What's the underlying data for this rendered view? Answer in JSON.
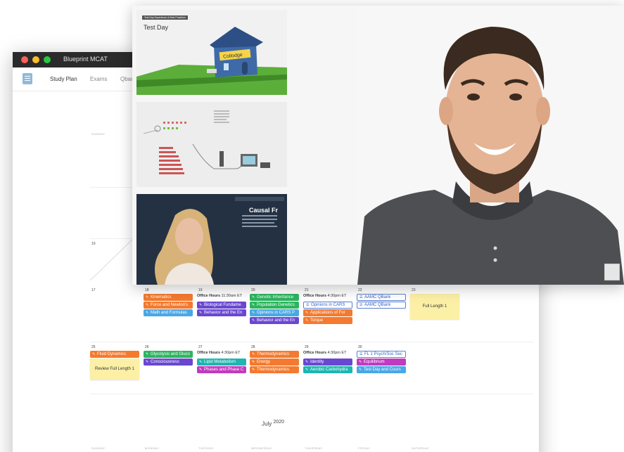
{
  "window": {
    "title": "Blueprint MCAT"
  },
  "nav": {
    "items": [
      "Study Plan",
      "Exams",
      "Qban"
    ]
  },
  "calendar": {
    "week_header_top": {
      "sunday": "SUNDAY"
    },
    "partial_day": "10",
    "week1": {
      "days": [
        "17",
        "18",
        "19",
        "20",
        "21",
        "22",
        "23"
      ],
      "events": [
        {
          "day": "18",
          "label": "Kinematics",
          "color": "orange"
        },
        {
          "day": "18",
          "label": "Force and Newton's",
          "color": "orange"
        },
        {
          "day": "18",
          "label": "Math and Formulas",
          "color": "blue"
        },
        {
          "day": "19",
          "label": "Biological Fundame",
          "color": "purple"
        },
        {
          "day": "19",
          "label": "Behavior and the En",
          "color": "purple"
        },
        {
          "day": "20",
          "label": "Genetic Inheritance",
          "color": "green"
        },
        {
          "day": "20",
          "label": "Population Genetics",
          "color": "green"
        },
        {
          "day": "20",
          "label": "Opinions in CARS P",
          "color": "blue"
        },
        {
          "day": "20",
          "label": "Behavior and the En",
          "color": "purple"
        },
        {
          "day": "21",
          "label": "Opinions in CARS",
          "color": "outline"
        },
        {
          "day": "21",
          "label": "Applications of For",
          "color": "orange"
        },
        {
          "day": "21",
          "label": "Torque",
          "color": "orange"
        },
        {
          "day": "22",
          "label": "AAMC QBank",
          "color": "outline"
        },
        {
          "day": "22",
          "label": "AAMC QBank",
          "color": "outline"
        }
      ],
      "office_hours": [
        {
          "day": "19",
          "bold": "Office Hours",
          "time": "11:30am ET"
        },
        {
          "day": "21",
          "bold": "Office Hours",
          "time": "4:30pm ET"
        }
      ],
      "sticky": {
        "day": "23",
        "label": "Full Length 1"
      }
    },
    "week2": {
      "days": [
        "25",
        "26",
        "27",
        "28",
        "29",
        "30"
      ],
      "events": [
        {
          "day": "25",
          "label": "Fluid Dynamics",
          "color": "orange"
        },
        {
          "day": "26",
          "label": "Glycolysis and Gluco",
          "color": "green"
        },
        {
          "day": "26",
          "label": "Consciousness",
          "color": "purple"
        },
        {
          "day": "27",
          "label": "Lipid Metabolism",
          "color": "teal"
        },
        {
          "day": "27",
          "label": "Phases and Phase C",
          "color": "magenta"
        },
        {
          "day": "28",
          "label": "Thermodynamics",
          "color": "orange"
        },
        {
          "day": "28",
          "label": "Energy",
          "color": "orange"
        },
        {
          "day": "28",
          "label": "Thermodynamics",
          "color": "orange"
        },
        {
          "day": "29",
          "label": "Identity",
          "color": "purple"
        },
        {
          "day": "29",
          "label": "Aerobic Carbohydra",
          "color": "teal"
        },
        {
          "day": "30",
          "label": "FL 1 Psych/Soc Sec",
          "color": "outline"
        },
        {
          "day": "30",
          "label": "Equilibrium",
          "color": "magenta"
        },
        {
          "day": "30",
          "label": "Test Day and Cours",
          "color": "blue"
        }
      ],
      "office_hours": [
        {
          "day": "27",
          "bold": "Office Hours",
          "time": "4:30pm ET"
        },
        {
          "day": "29",
          "bold": "Office Hours",
          "time": "4:30pm ET"
        }
      ],
      "sticky": {
        "day": "25",
        "label": "Review Full Length 1"
      }
    },
    "next_month": {
      "label": "July",
      "year": "2020"
    },
    "weekdays": [
      "SUNDAY",
      "MONDAY",
      "TUESDAY",
      "WEDNESDAY",
      "THURSDAY",
      "FRIDAY",
      "SATURDAY"
    ]
  },
  "video": {
    "thumbnails": [
      {
        "tag": "Test Day Experience & Best Practices",
        "title": "Test Day",
        "sign": "Collodge"
      },
      {
        "tag": "",
        "title": ""
      },
      {
        "tag": "",
        "title": "Causal Fr"
      }
    ]
  },
  "colors": {
    "orange": "#f47a2f",
    "green": "#2cb55f",
    "purple": "#6a47d1",
    "blue": "#4aa7e6",
    "teal": "#1fb5b0",
    "magenta": "#c03bbf",
    "sticky": "#fcf0a6"
  }
}
